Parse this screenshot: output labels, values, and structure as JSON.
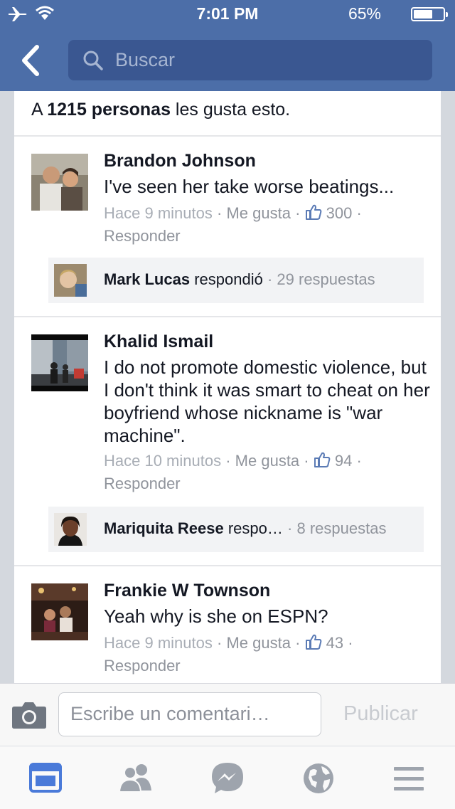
{
  "status_bar": {
    "time": "7:01 PM",
    "battery": "65%",
    "battery_fraction": 0.65
  },
  "header": {
    "search_placeholder": "Buscar"
  },
  "likes_summary": {
    "prefix": "A",
    "count_phrase": "1215 personas",
    "suffix": "les gusta esto."
  },
  "comments": [
    {
      "author": "Brandon Johnson",
      "text": "I've seen her take worse beatings...",
      "time": "Hace 9 minutos",
      "like_label": "Me gusta",
      "like_count": "300",
      "reply_label": "Responder",
      "reply_preview": {
        "name": "Mark Lucas",
        "action": "respondió",
        "count": "29 respuestas"
      }
    },
    {
      "author": "Khalid Ismail",
      "text": "I do not promote domestic violence, but I don't think it was smart to cheat on her boyfriend whose nickname is \"war machine\".",
      "time": "Hace 10 minutos",
      "like_label": "Me gusta",
      "like_count": "94",
      "reply_label": "Responder",
      "reply_preview": {
        "name": "Mariquita Reese",
        "action": "respo…",
        "count": "8 respuestas"
      }
    },
    {
      "author": "Frankie W Townson",
      "text": "Yeah why is she on ESPN?",
      "time": "Hace 9 minutos",
      "like_label": "Me gusta",
      "like_count": "43",
      "reply_label": "Responder"
    }
  ],
  "composer": {
    "placeholder": "Escribe un comentari…",
    "publish_label": "Publicar"
  },
  "tabbar": {
    "items": [
      {
        "icon": "news-feed-icon",
        "active": true
      },
      {
        "icon": "friends-icon",
        "active": false
      },
      {
        "icon": "messenger-icon",
        "active": false
      },
      {
        "icon": "globe-icon",
        "active": false
      },
      {
        "icon": "menu-icon",
        "active": false
      }
    ]
  },
  "colors": {
    "brand_blue": "#4c6ea8",
    "search_bg": "#3a5791",
    "active_tab": "#4a7ad9",
    "inactive_tab": "#9ea4ad"
  }
}
